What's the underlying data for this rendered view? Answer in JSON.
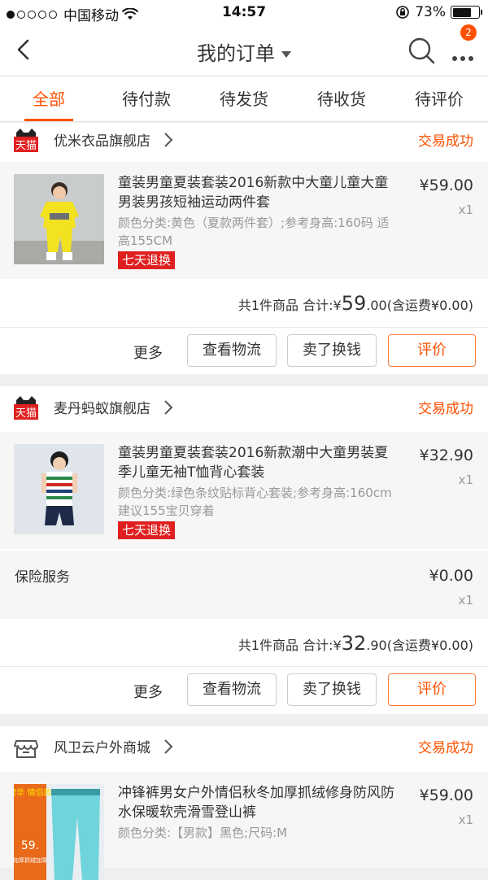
{
  "status_bar": {
    "carrier": "中国移动",
    "time": "14:57",
    "battery": "73%",
    "battery_level": 0.73
  },
  "nav": {
    "title": "我的订单",
    "badge": "2"
  },
  "tabs": [
    {
      "label": "全部",
      "active": true
    },
    {
      "label": "待付款"
    },
    {
      "label": "待发货"
    },
    {
      "label": "待收货"
    },
    {
      "label": "待评价"
    }
  ],
  "orders": [
    {
      "shop": "优米衣品旗舰店",
      "shop_badge": "天猫",
      "status": "交易成功",
      "item": {
        "title": "童装男童夏装套装2016新款中大童儿童大童男装男孩短袖运动两件套",
        "sku": "颜色分类:黄色（夏款两件套）;参考身高:160码 适高155CM",
        "tag": "七天退换",
        "price": "¥59.00",
        "qty": "x1"
      },
      "summary": {
        "prefix": "共1件商品 合计:¥",
        "big": "59",
        "small": ".00",
        "suffix": "(含运费¥0.00)"
      },
      "more": "更多",
      "buttons": [
        "查看物流",
        "卖了换钱",
        "评价"
      ]
    },
    {
      "shop": "麦丹蚂蚁旗舰店",
      "shop_badge": "天猫",
      "status": "交易成功",
      "item": {
        "title": "童装男童夏装套装2016新款潮中大童男装夏季儿童无袖T恤背心套装",
        "sku": "颜色分类:绿色条纹贴标背心套装;参考身高:160cm建议155宝贝穿着",
        "tag": "七天退换",
        "price": "¥32.90",
        "qty": "x1"
      },
      "service": {
        "name": "保险服务",
        "price": "¥0.00",
        "qty": "x1"
      },
      "summary": {
        "prefix": "共1件商品 合计:¥",
        "big": "32",
        "small": ".90",
        "suffix": "(含运费¥0.00)"
      },
      "more": "更多",
      "buttons": [
        "查看物流",
        "卖了换钱",
        "评价"
      ]
    },
    {
      "shop": "风卫云户外商城",
      "status": "交易成功",
      "item": {
        "title": "冲锋裤男女户外情侣秋冬加厚抓绒修身防风防水保暖软壳滑雪登山裤",
        "sku": "颜色分类:【男款】黑色;尺码:M",
        "price": "¥59.00",
        "qty": "x1",
        "thumb_text_top": "奢华\n情侣款",
        "thumb_price": "59.",
        "thumb_sub": "加厚抓绒加厚"
      }
    }
  ]
}
